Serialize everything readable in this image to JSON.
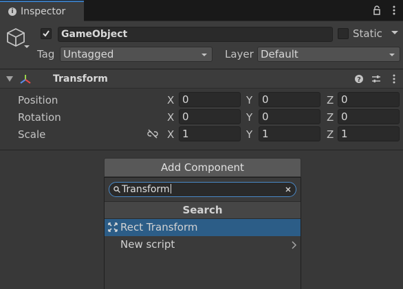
{
  "tab": {
    "title": "Inspector"
  },
  "header": {
    "active": true,
    "object_name": "GameObject",
    "static_label": "Static",
    "static_checked": false,
    "tag_label": "Tag",
    "tag_value": "Untagged",
    "layer_label": "Layer",
    "layer_value": "Default"
  },
  "transform": {
    "title": "Transform",
    "rows": [
      {
        "label": "Position",
        "x": "0",
        "y": "0",
        "z": "0"
      },
      {
        "label": "Rotation",
        "x": "0",
        "y": "0",
        "z": "0"
      },
      {
        "label": "Scale",
        "x": "1",
        "y": "1",
        "z": "1"
      }
    ],
    "axis_labels": {
      "x": "X",
      "y": "Y",
      "z": "Z"
    }
  },
  "add_component": {
    "button_label": "Add Component",
    "search_value": "Transform",
    "section_title": "Search",
    "items": [
      {
        "label": "Rect Transform",
        "selected": true
      },
      {
        "label": "New script",
        "selected": false
      }
    ]
  },
  "colors": {
    "accent": "#3a79bb",
    "selection": "#2c5d87",
    "panel": "#3c3c3c",
    "field": "#2a2a2a"
  }
}
